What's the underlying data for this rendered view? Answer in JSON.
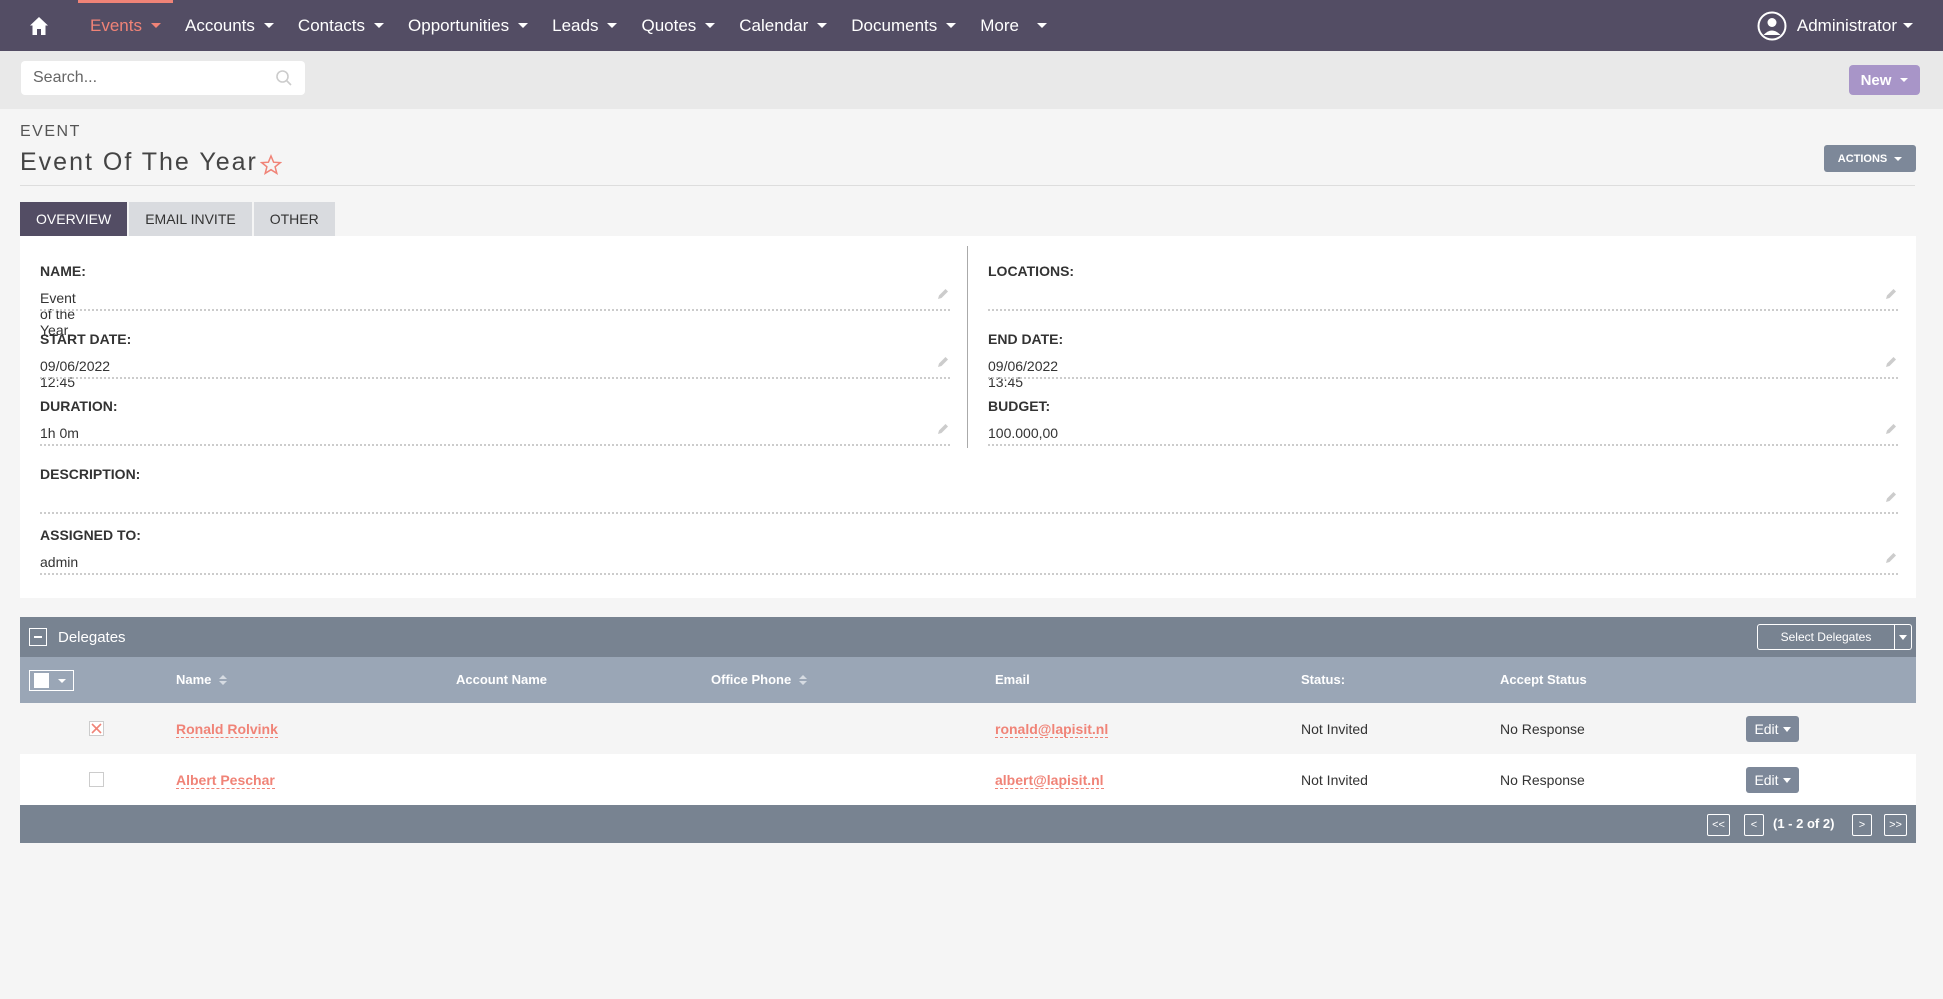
{
  "nav": {
    "items": [
      {
        "label": "Events",
        "active": true
      },
      {
        "label": "Accounts"
      },
      {
        "label": "Contacts"
      },
      {
        "label": "Opportunities"
      },
      {
        "label": "Leads"
      },
      {
        "label": "Quotes"
      },
      {
        "label": "Calendar"
      },
      {
        "label": "Documents"
      },
      {
        "label": "More"
      }
    ],
    "user": "Administrator",
    "accent_color": "#f08377",
    "bar_color": "#534d64"
  },
  "search": {
    "placeholder": "Search..."
  },
  "new_label": "New",
  "header": {
    "module": "EVENT",
    "title": "Event Of The Year",
    "actions_label": "ACTIONS"
  },
  "tabs": [
    {
      "label": "OVERVIEW",
      "active": true
    },
    {
      "label": "EMAIL INVITE"
    },
    {
      "label": "OTHER"
    }
  ],
  "fields": {
    "name": {
      "label": "NAME:",
      "value": "Event of the Year"
    },
    "locations": {
      "label": "LOCATIONS:",
      "value": ""
    },
    "start_date": {
      "label": "START DATE:",
      "value": "09/06/2022 12:45"
    },
    "end_date": {
      "label": "END DATE:",
      "value": "09/06/2022 13:45"
    },
    "duration": {
      "label": "DURATION:",
      "value": "1h 0m"
    },
    "budget": {
      "label": "BUDGET:",
      "value": "100.000,00"
    },
    "description": {
      "label": "DESCRIPTION:",
      "value": ""
    },
    "assigned_to": {
      "label": "ASSIGNED TO:",
      "value": "admin"
    }
  },
  "delegates": {
    "title": "Delegates",
    "select_label": "Select Delegates",
    "columns": {
      "name": "Name",
      "account_name": "Account Name",
      "office_phone": "Office Phone",
      "email": "Email",
      "status": "Status:",
      "accept_status": "Accept Status"
    },
    "rows": [
      {
        "name": "Ronald Rolvink",
        "email": "ronald@lapisit.nl",
        "status": "Not Invited",
        "accept_status": "No Response",
        "edit": "Edit",
        "checked": true
      },
      {
        "name": "Albert Peschar",
        "email": "albert@lapisit.nl",
        "status": "Not Invited",
        "accept_status": "No Response",
        "edit": "Edit",
        "checked": false
      }
    ],
    "pagination": {
      "first": "<<",
      "prev": "<",
      "text": "(1 - 2 of 2)",
      "next": ">",
      "last": ">>"
    }
  }
}
